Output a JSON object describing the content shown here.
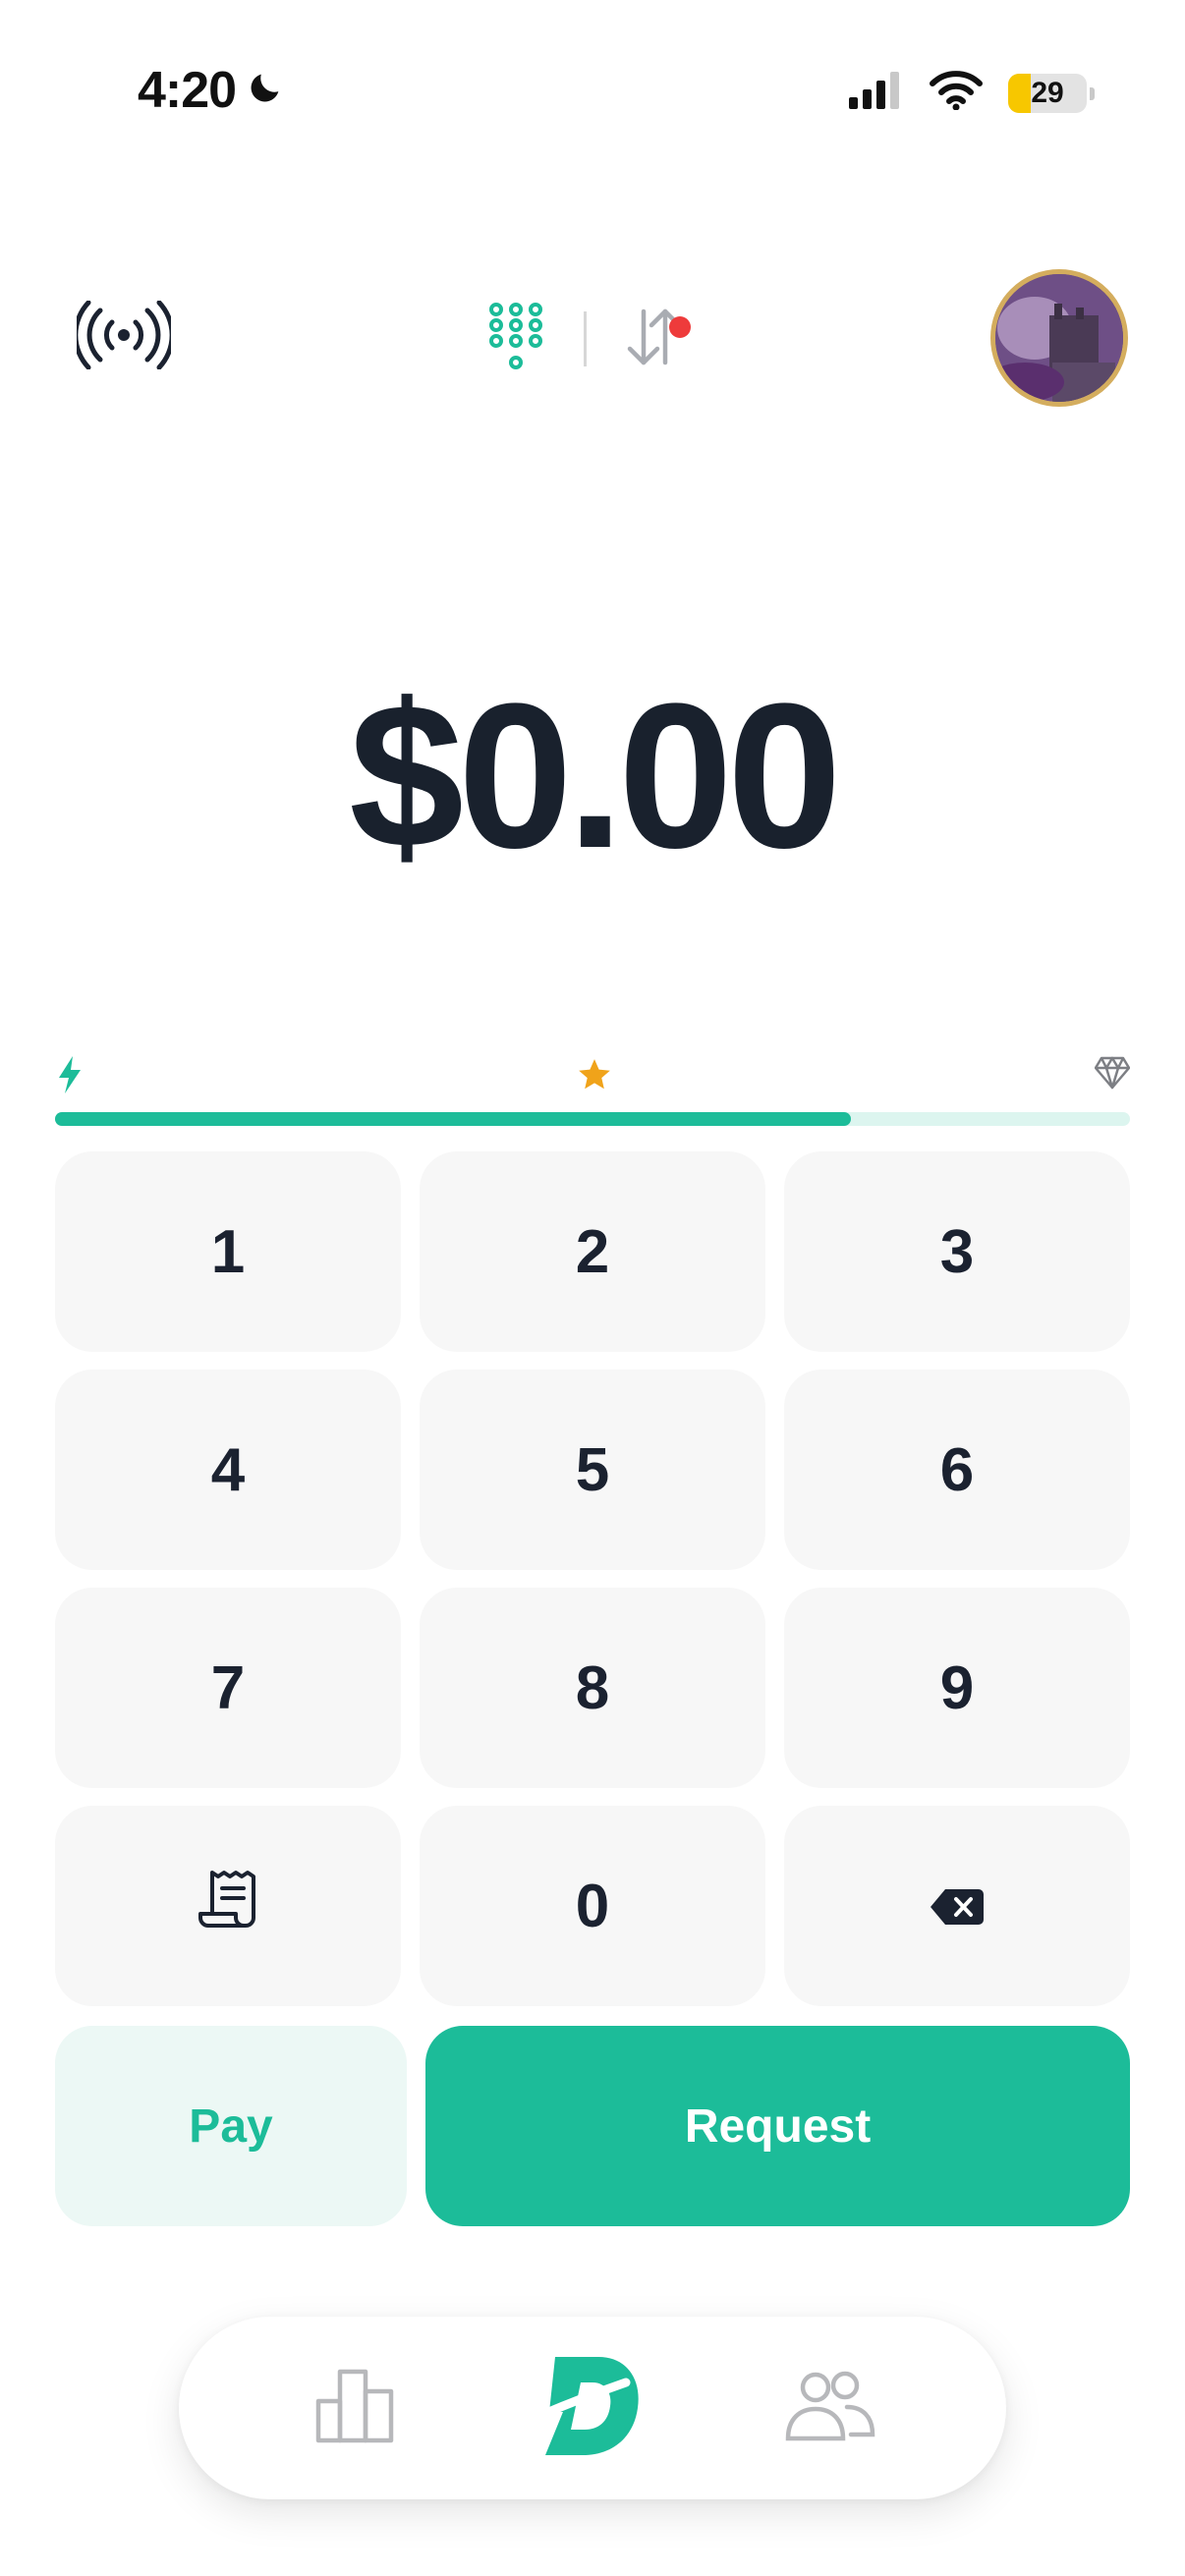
{
  "status_bar": {
    "time": "4:20",
    "battery_level": "29",
    "battery_fraction": 0.29,
    "icons": [
      "moon-icon",
      "cellular-signal-icon",
      "wifi-icon",
      "battery-icon"
    ]
  },
  "top_bar": {
    "left_icon": "nearby-broadcast-icon",
    "mode_icons": [
      "keypad-icon",
      "transfer-arrows-icon"
    ],
    "activity_has_notification": true,
    "avatar": "profile-avatar"
  },
  "amount": {
    "display": "$0.00"
  },
  "progress": {
    "icons": [
      "bolt-icon",
      "star-icon",
      "diamond-icon"
    ],
    "fill_fraction": 0.74
  },
  "keypad": {
    "keys": [
      "1",
      "2",
      "3",
      "4",
      "5",
      "6",
      "7",
      "8",
      "9",
      "",
      "0",
      ""
    ],
    "special_keys": [
      "receipt-icon",
      "backspace-icon"
    ]
  },
  "actions": {
    "pay_label": "Pay",
    "request_label": "Request"
  },
  "bottom_nav": {
    "items": [
      "stats-bar-icon",
      "brand-logo-icon",
      "people-icon"
    ]
  },
  "colors": {
    "accent": "#1cbc99",
    "accent_light": "#ecf8f5",
    "text_dark": "#19212d",
    "key_background": "#f7f7f7",
    "star": "#f0a31a",
    "notification": "#ee3b3b",
    "battery_fill": "#f7c700"
  }
}
